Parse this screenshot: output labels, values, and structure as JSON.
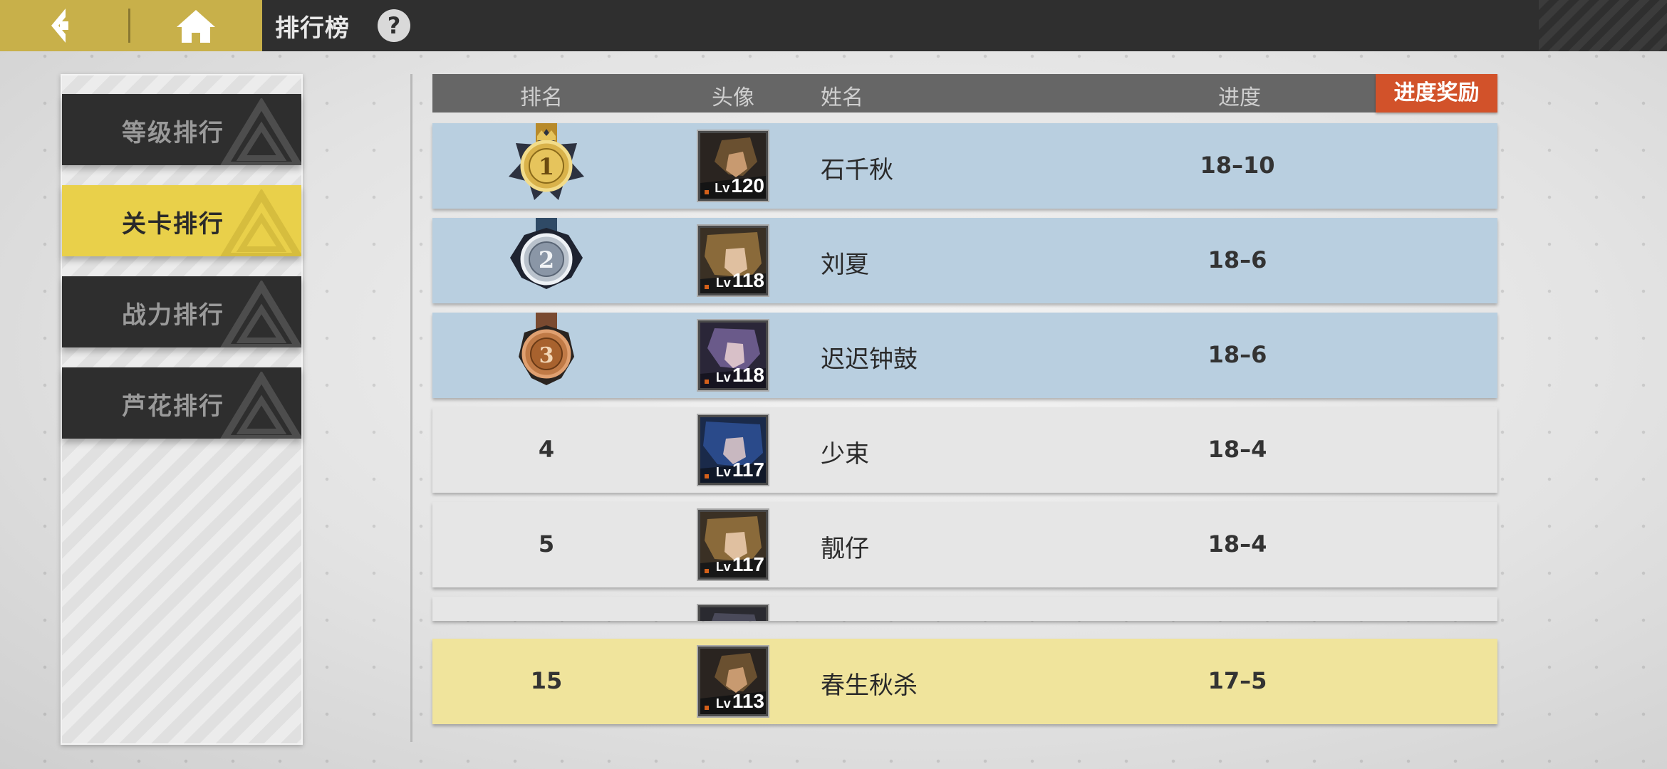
{
  "header": {
    "title": "排行榜",
    "help_icon": "?"
  },
  "sidebar": {
    "tabs": [
      {
        "label": "等级排行",
        "active": false
      },
      {
        "label": "关卡排行",
        "active": true
      },
      {
        "label": "战力排行",
        "active": false
      },
      {
        "label": "芦花排行",
        "active": false
      }
    ]
  },
  "table": {
    "columns": {
      "rank": "排名",
      "avatar": "头像",
      "name": "姓名",
      "progress": "进度"
    },
    "reward_button": "进度奖励",
    "rows": [
      {
        "rank": "1",
        "medal": "gold-medal-icon",
        "level_prefix": "Lv",
        "level": "120",
        "name": "石千秋",
        "progress": "18–10"
      },
      {
        "rank": "2",
        "medal": "silver-medal-icon",
        "level_prefix": "Lv",
        "level": "118",
        "name": "刘夏",
        "progress": "18–6"
      },
      {
        "rank": "3",
        "medal": "bronze-medal-icon",
        "level_prefix": "Lv",
        "level": "118",
        "name": "迟迟钟鼓",
        "progress": "18–6"
      },
      {
        "rank": "4",
        "level_prefix": "Lv",
        "level": "117",
        "name": "少束",
        "progress": "18–4"
      },
      {
        "rank": "5",
        "level_prefix": "Lv",
        "level": "117",
        "name": "靓仔",
        "progress": "18–4"
      }
    ],
    "self_row": {
      "rank": "15",
      "level_prefix": "Lv",
      "level": "113",
      "name": "春生秋杀",
      "progress": "17–5"
    }
  },
  "colors": {
    "gold_accent": "#c8b04a",
    "active_tab": "#e9d04a",
    "reward_button": "#d2522a",
    "top3_row": "#b9cfe0",
    "self_row": "#f0e49c"
  }
}
